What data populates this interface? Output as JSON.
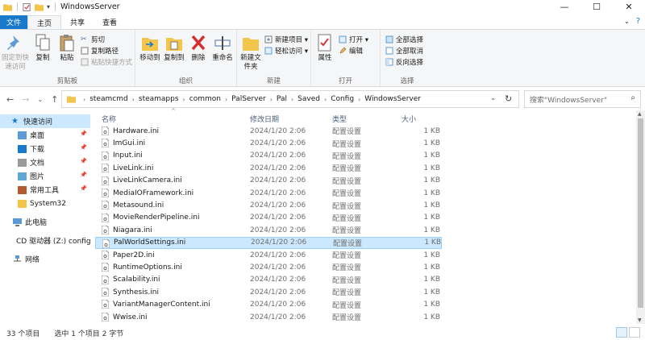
{
  "window": {
    "title": "WindowsServer",
    "controls": {
      "minimize": "—",
      "maximize": "☐",
      "close": "✕"
    }
  },
  "ribbon_tabs": {
    "file": "文件",
    "home": "主页",
    "share": "共享",
    "view": "查看"
  },
  "ribbon": {
    "clipboard": {
      "label": "剪贴板",
      "pin": "固定到快速访问",
      "copy": "复制",
      "paste": "粘贴",
      "cut": "剪切",
      "copy_path": "复制路径",
      "paste_shortcut": "粘贴快捷方式"
    },
    "organize": {
      "label": "组织",
      "move_to": "移动到",
      "copy_to": "复制到",
      "delete": "删除",
      "rename": "重命名"
    },
    "new": {
      "label": "新建",
      "new_folder": "新建文件夹",
      "new_item": "新建项目 ▾",
      "easy_access": "轻松访问 ▾"
    },
    "open": {
      "label": "打开",
      "properties": "属性",
      "open": "打开 ▾",
      "edit": "编辑"
    },
    "select": {
      "label": "选择",
      "select_all": "全部选择",
      "select_none": "全部取消",
      "invert": "反向选择"
    }
  },
  "address": {
    "crumbs": [
      "steamcmd",
      "steamapps",
      "common",
      "PalServer",
      "Pal",
      "Saved",
      "Config",
      "WindowsServer"
    ],
    "search_placeholder": "搜索\"WindowsServer\""
  },
  "nav": {
    "quick_access": "快速访问",
    "items": [
      {
        "label": "桌面",
        "pinned": true
      },
      {
        "label": "下载",
        "pinned": true
      },
      {
        "label": "文档",
        "pinned": true
      },
      {
        "label": "图片",
        "pinned": true
      },
      {
        "label": "常用工具",
        "pinned": true
      },
      {
        "label": "System32",
        "pinned": false
      }
    ],
    "this_pc": "此电脑",
    "cd_drive": "CD 驱动器 (Z:) config",
    "network": "网络"
  },
  "columns": {
    "name": "名称",
    "date": "修改日期",
    "type": "类型",
    "size": "大小"
  },
  "files": [
    {
      "name": "Hardware.ini",
      "date": "2024/1/20 2:06",
      "type": "配置设置",
      "size": "1 KB"
    },
    {
      "name": "ImGui.ini",
      "date": "2024/1/20 2:06",
      "type": "配置设置",
      "size": "1 KB"
    },
    {
      "name": "Input.ini",
      "date": "2024/1/20 2:06",
      "type": "配置设置",
      "size": "1 KB"
    },
    {
      "name": "LiveLink.ini",
      "date": "2024/1/20 2:06",
      "type": "配置设置",
      "size": "1 KB"
    },
    {
      "name": "LiveLinkCamera.ini",
      "date": "2024/1/20 2:06",
      "type": "配置设置",
      "size": "1 KB"
    },
    {
      "name": "MediaIOFramework.ini",
      "date": "2024/1/20 2:06",
      "type": "配置设置",
      "size": "1 KB"
    },
    {
      "name": "Metasound.ini",
      "date": "2024/1/20 2:06",
      "type": "配置设置",
      "size": "1 KB"
    },
    {
      "name": "MovieRenderPipeline.ini",
      "date": "2024/1/20 2:06",
      "type": "配置设置",
      "size": "1 KB"
    },
    {
      "name": "Niagara.ini",
      "date": "2024/1/20 2:06",
      "type": "配置设置",
      "size": "1 KB"
    },
    {
      "name": "PalWorldSettings.ini",
      "date": "2024/1/20 2:06",
      "type": "配置设置",
      "size": "1 KB",
      "selected": true
    },
    {
      "name": "Paper2D.ini",
      "date": "2024/1/20 2:06",
      "type": "配置设置",
      "size": "1 KB"
    },
    {
      "name": "RuntimeOptions.ini",
      "date": "2024/1/20 2:06",
      "type": "配置设置",
      "size": "1 KB"
    },
    {
      "name": "Scalability.ini",
      "date": "2024/1/20 2:06",
      "type": "配置设置",
      "size": "1 KB"
    },
    {
      "name": "Synthesis.ini",
      "date": "2024/1/20 2:06",
      "type": "配置设置",
      "size": "1 KB"
    },
    {
      "name": "VariantManagerContent.ini",
      "date": "2024/1/20 2:06",
      "type": "配置设置",
      "size": "1 KB"
    },
    {
      "name": "Wwise.ini",
      "date": "2024/1/20 2:06",
      "type": "配置设置",
      "size": "1 KB"
    }
  ],
  "status": {
    "count": "33 个项目",
    "selection": "选中 1 个项目 2 字节"
  },
  "colors": {
    "accent": "#1979ca",
    "selection": "#cce8ff",
    "selection_border": "#99d1ff",
    "folder": "#f3c54b"
  }
}
